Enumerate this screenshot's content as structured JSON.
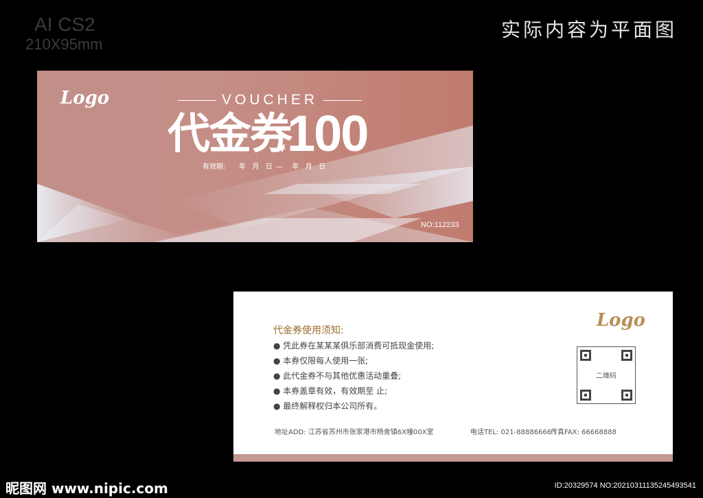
{
  "meta": {
    "version_label": "AI CS2",
    "size_label": "210X95mm",
    "note": "实际内容为平面图"
  },
  "front": {
    "logo": "Logo",
    "voucher_label": "VOUCHER",
    "title": "代金券",
    "currency": "¥",
    "amount": "100",
    "validity_label": "有效期:",
    "validity_date": "年  月  日 —   年  月  日",
    "serial": "NO:112233"
  },
  "back": {
    "logo": "Logo",
    "rules_title": "代金券使用须知:",
    "rules": [
      "● 凭此券在某某某俱乐部消费可抵现金使用;",
      "● 本券仅限每人使用一张;",
      "● 此代金券不与其他优惠活动重叠;",
      "● 本券盖章有效，有效期至            止;",
      "● 最终解释权归本公司所有。"
    ],
    "qr_label": "二维码",
    "address": "地址ADD: 江苏省苏州市张家港市杨舍镇6X幢00X室",
    "tel": "电话TEL: 021-88886666",
    "fax": "传真FAX: 66668888"
  },
  "watermark": {
    "site": "昵图网 www.nipic.com",
    "id": "ID:20329574 NO:20210311135245493541"
  },
  "colors": {
    "front_bg": "#c28f89",
    "front_bg_dark": "#c07b6e",
    "accent_gold": "#b79055",
    "back_bar": "#c49791",
    "page_bg": "#000000"
  }
}
